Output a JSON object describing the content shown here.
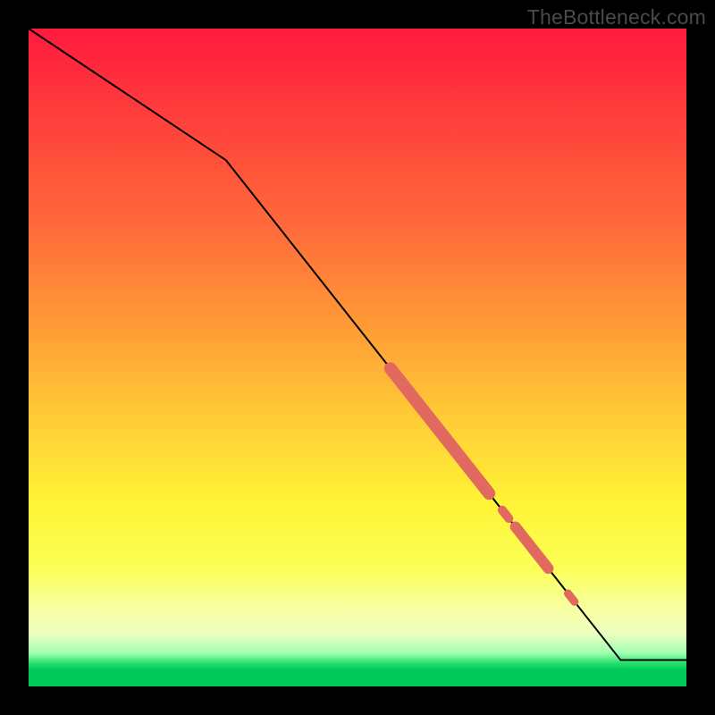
{
  "watermark": "TheBottleneck.com",
  "colors": {
    "line": "#000000",
    "highlight": "#e2695f",
    "background_black": "#000000"
  },
  "chart_data": {
    "type": "line",
    "title": "",
    "xlabel": "",
    "ylabel": "",
    "xlim": [
      0,
      100
    ],
    "ylim": [
      0,
      100
    ],
    "grid": false,
    "legend": false,
    "series": [
      {
        "name": "curve",
        "x": [
          0,
          30,
          90,
          100
        ],
        "y": [
          100,
          80,
          4,
          4
        ],
        "stroke": "#000000",
        "stroke_width": 2
      }
    ],
    "highlighted_segments": [
      {
        "name": "band-a",
        "x_start": 55,
        "x_end": 70,
        "thickness": 14
      },
      {
        "name": "dot-a",
        "x_start": 72,
        "x_end": 73,
        "thickness": 10
      },
      {
        "name": "band-b",
        "x_start": 74,
        "x_end": 79,
        "thickness": 12
      },
      {
        "name": "dot-b",
        "x_start": 82,
        "x_end": 83,
        "thickness": 9
      }
    ],
    "background_gradient": {
      "direction": "vertical",
      "stops": [
        {
          "pos": 0.0,
          "color": "#ff1a3d"
        },
        {
          "pos": 0.45,
          "color": "#ff9a36"
        },
        {
          "pos": 0.72,
          "color": "#fff335"
        },
        {
          "pos": 0.92,
          "color": "#ecffc0"
        },
        {
          "pos": 0.97,
          "color": "#00c85a"
        },
        {
          "pos": 1.0,
          "color": "#00c85a"
        }
      ]
    }
  }
}
